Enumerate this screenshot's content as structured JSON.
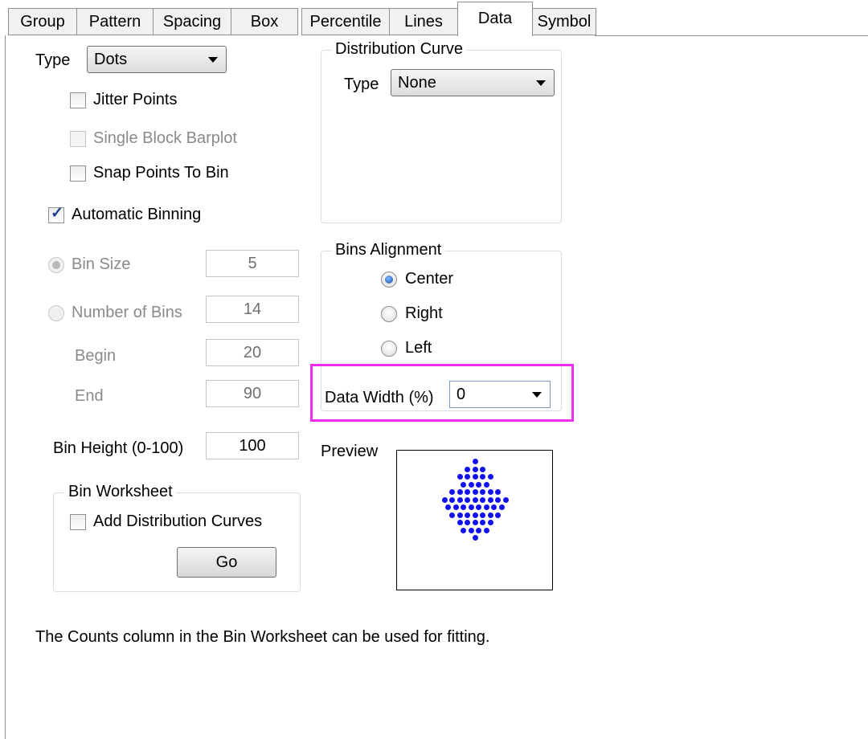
{
  "tabs": [
    "Group",
    "Pattern",
    "Spacing",
    "Box",
    "Percentile",
    "Lines",
    "Data",
    "Symbol"
  ],
  "active_tab": "Data",
  "type": {
    "label": "Type",
    "value": "Dots"
  },
  "checkboxes": {
    "jitter_points": {
      "label": "Jitter Points",
      "checked": false
    },
    "single_block_barplot": {
      "label": "Single Block Barplot",
      "checked": false,
      "enabled": false
    },
    "snap_points_to_bin": {
      "label": "Snap Points To Bin",
      "checked": false
    },
    "automatic_binning": {
      "label": "Automatic Binning",
      "checked": true
    }
  },
  "binning": {
    "bin_size": {
      "label": "Bin Size",
      "value": "5",
      "selected": true
    },
    "number_of_bins": {
      "label": "Number of Bins",
      "value": "14",
      "selected": false
    },
    "begin": {
      "label": "Begin",
      "value": "20"
    },
    "end": {
      "label": "End",
      "value": "90"
    }
  },
  "bin_height": {
    "label": "Bin Height (0-100)",
    "value": "100"
  },
  "bin_worksheet": {
    "legend": "Bin Worksheet",
    "add_curves_label": "Add Distribution Curves",
    "go_label": "Go"
  },
  "distribution_curve": {
    "legend": "Distribution Curve",
    "type_label": "Type",
    "type_value": "None"
  },
  "bins_alignment": {
    "legend": "Bins Alignment",
    "options": [
      "Center",
      "Right",
      "Left"
    ],
    "selected": "Center"
  },
  "data_width": {
    "label": "Data Width (%)",
    "value": "0"
  },
  "preview": {
    "label": "Preview",
    "rows": [
      1,
      3,
      5,
      4,
      7,
      9,
      8,
      7,
      5,
      4,
      1
    ]
  },
  "note": "The Counts column in the Bin Worksheet can be used for fitting.",
  "colors": {
    "highlight": "#f030f0",
    "preview_dot": "#1010f0"
  }
}
